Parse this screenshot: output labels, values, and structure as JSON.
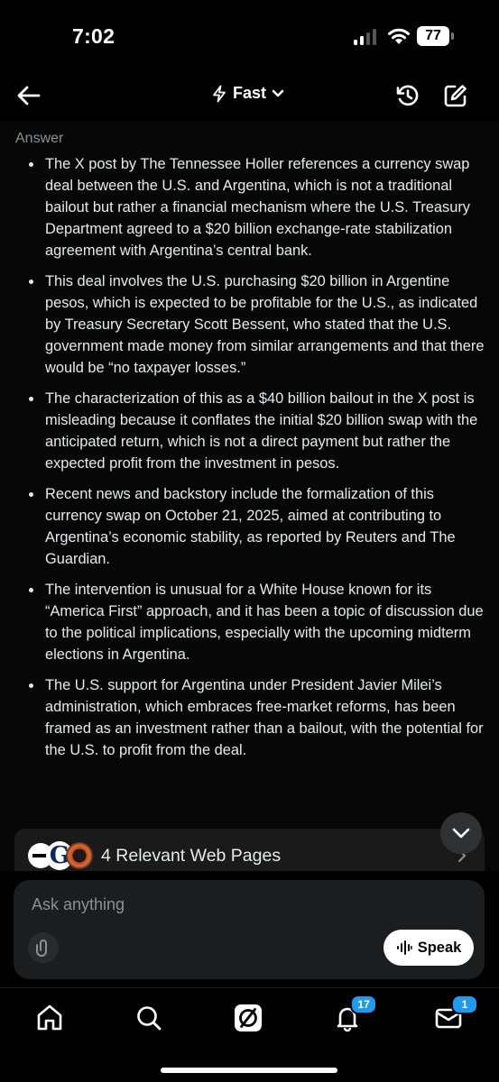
{
  "status_bar": {
    "time": "7:02",
    "battery": "77"
  },
  "header": {
    "mode_label": "Fast"
  },
  "answer": {
    "label": "Answer",
    "bullets": [
      "The X post by The Tennessee Holler references a currency swap deal between the U.S. and Argentina, which is not a traditional bailout but rather a financial mechanism where the U.S. Treasury Department agreed to a $20 billion exchange-rate stabilization agreement with Argentina’s central bank.",
      "This deal involves the U.S. purchasing $20 billion in Argentine pesos, which is expected to be profitable for the U.S., as indicated by Treasury Secretary Scott Bessent, who stated that the U.S. government made money from similar arrangements and that there would be “no taxpayer losses.”",
      "The characterization of this as a $40 billion bailout in the X post is misleading because it conflates the initial $20 billion swap with the anticipated return, which is not a direct payment but rather the expected profit from the investment in pesos.",
      "Recent news and backstory include the formalization of this currency swap on October 21, 2025, aimed at contributing to Argentina’s economic stability, as reported by Reuters and The Guardian.",
      "The intervention is unusual for a White House known for its “America First” approach, and it has been a topic of discussion due to the political implications, especially with the upcoming midterm elections in Argentina.",
      "The U.S. support for Argentina under President Javier Milei’s administration, which embraces free-market reforms, has been framed as an investment rather than a bailout, with the potential for the U.S. to profit from the deal."
    ]
  },
  "sources": {
    "label": "4 Relevant Web Pages",
    "guardian_letter": "G"
  },
  "input": {
    "placeholder": "Ask anything",
    "speak_label": "Speak"
  },
  "tabbar": {
    "notifications_badge": "17",
    "messages_badge": "1"
  },
  "colors": {
    "accent": "#1d9bf0",
    "background": "#000000",
    "text": "#e7e9ea",
    "muted": "#8b9096"
  }
}
